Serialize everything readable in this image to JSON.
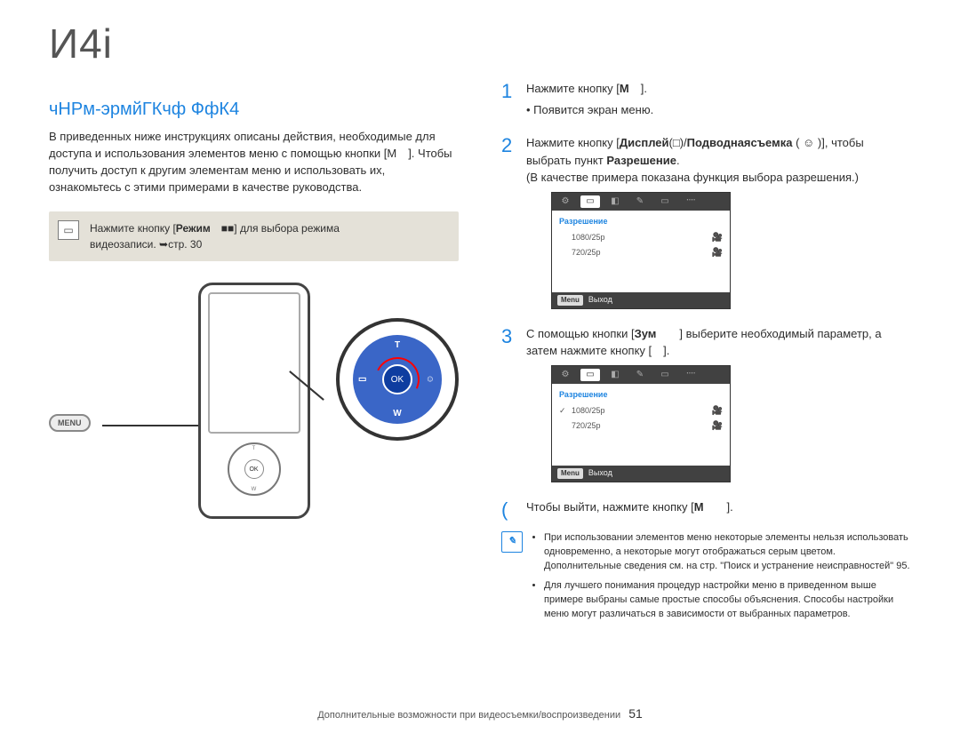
{
  "page_heading": "И4і",
  "subtitle": "чНРм-эрмйГКчф ФфК4",
  "intro_paragraph": "В приведенных ниже инструкциях описаны действия, необходимые для доступа и использования элементов меню с помощью кнопки [M ]. Чтобы   получить доступ к другим элементам меню и использовать их, ознакомьтесь с этими примерами в качестве руководства.",
  "note_line1_a": "Нажмите кнопку [",
  "note_line1_bold": "Режим ■■",
  "note_line1_b": "] для выбора режима",
  "note_line2": "видеозаписи. ➥стр. 30",
  "menu_chip_label": "MENU",
  "dial": {
    "ok": "OK",
    "t": "T",
    "w": "W"
  },
  "steps": {
    "s1": {
      "num": "1",
      "a": "Нажмите кнопку [",
      "bold": "M ",
      "b": "].",
      "bullet": "Появится экран меню."
    },
    "s2": {
      "num": "2",
      "a": "Нажмите кнопку [",
      "bold1": "Дисплей",
      "mid": "(□)/",
      "bold2": "Подводнаясъемка",
      "tail": " ( ☺ )], чтобы выбрать пункт ",
      "bold3": "Разрешение",
      "period": ".",
      "par": "(В качестве примера показана функция выбора разрешения.)"
    },
    "s3": {
      "num": "3",
      "a": "С помощью кнопки [",
      "bold1": "Зум  ",
      "mid": "] выберите необходимый параметр, а затем нажмите кнопку [",
      "bold2": " ",
      "tail": "]."
    },
    "s4": {
      "brac": "(",
      "text_a": "Чтобы выйти, нажмите кнопку [",
      "bold": "M  ",
      "text_b": "]."
    }
  },
  "ui": {
    "section_label": "Разрешение",
    "rows": [
      {
        "label": "1080/25p",
        "checked": false
      },
      {
        "label": "720/25p",
        "checked": false
      }
    ],
    "rows2": [
      {
        "label": "1080/25p",
        "checked": true
      },
      {
        "label": "720/25p",
        "checked": false
      }
    ],
    "exit_tag": "Menu",
    "exit_label": "Выход"
  },
  "info": {
    "li1": "При использовании элементов меню некоторые элементы нельзя использовать одновременно, а некоторые могут отображаться серым цветом. Дополнительные сведения см. на стр. \"Поиск и устранение неисправностей\" 95.",
    "li2": "Для лучшего понимания процедур настройки меню в приведенном выше примере выбраны самые простые способы объяснения. Способы настройки меню могут различаться в зависимости от выбранных параметров."
  },
  "footer_text": "Дополнительные возможности при видеосъемки/воспроизведении",
  "page_number": "51"
}
